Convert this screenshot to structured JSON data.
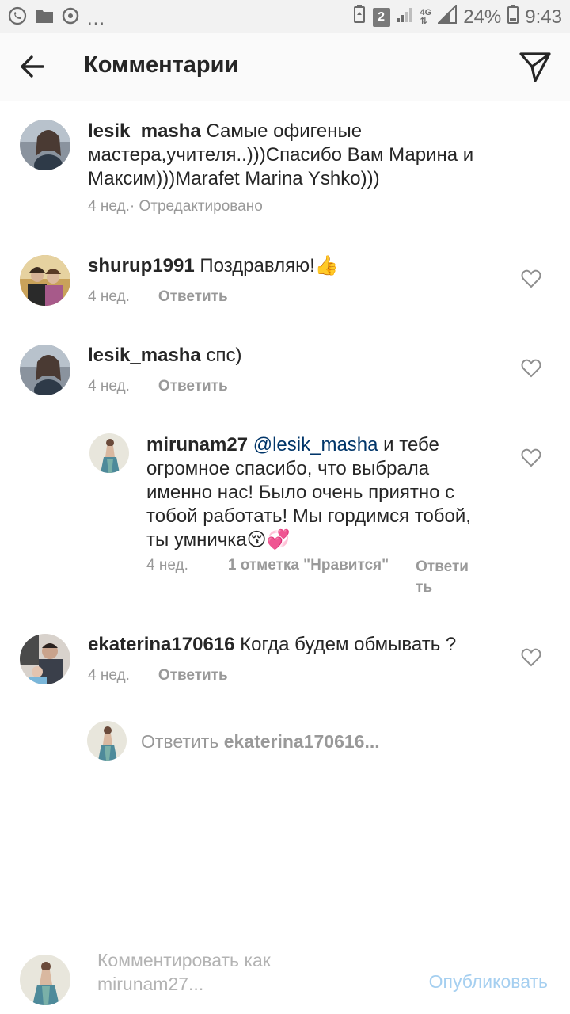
{
  "status_bar": {
    "battery_percent": "24%",
    "time": "9:43",
    "sim_badge": "2",
    "network": "4G",
    "dots": "..."
  },
  "header": {
    "title": "Комментарии"
  },
  "caption": {
    "username": "lesik_masha",
    "text": " Самые офигеные мастера,учителя..)))Спасибо Вам Марина и Максим)))Marafet Marina Yshko)))",
    "time": "4 нед.",
    "edited": " · Отредактировано"
  },
  "comments": [
    {
      "username": "shurup1991",
      "text": " Поздравляю!👍",
      "time": "4 нед.",
      "reply_label": "Ответить"
    },
    {
      "username": "lesik_masha",
      "text": " спс)",
      "time": "4 нед.",
      "reply_label": "Ответить"
    },
    {
      "username": "mirunam27",
      "mention": "@lesik_masha",
      "text": " и тебе огромное спасибо, что выбрала именно нас! Было очень приятно с тобой работать! Мы гордимся тобой, ты умничка😚💞",
      "time": "4 нед.",
      "likes": "1 отметка \"Нравится\"",
      "reply_label_line1": "Ответи",
      "reply_label_line2": "ть"
    },
    {
      "username": "ekaterina170616",
      "text": " Когда будем обмывать ?",
      "time": "4 нед.",
      "reply_label": "Ответить"
    }
  ],
  "reply_composer": {
    "prefix": "Ответить ",
    "target": "ekaterina170616..."
  },
  "bottom_bar": {
    "placeholder_line1": "Комментировать как",
    "placeholder_line2": "mirunam27...",
    "publish_label": "Опубликовать"
  },
  "colors": {
    "header_bg": "#fafafa",
    "text": "#262626",
    "meta": "#999999",
    "mention": "#003569",
    "publish": "#a5cff0"
  }
}
